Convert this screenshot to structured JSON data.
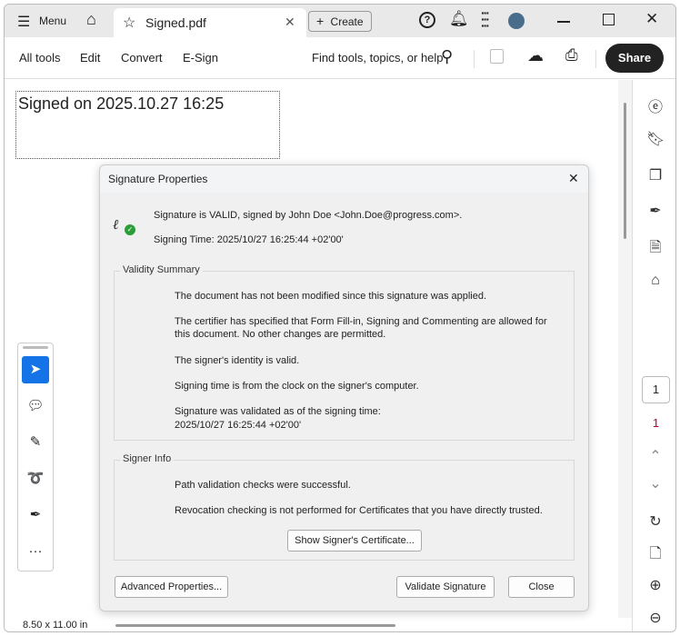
{
  "titlebar": {
    "menu": "Menu",
    "tab_title": "Signed.pdf",
    "create": "Create"
  },
  "toolbar": {
    "all_tools": "All tools",
    "edit": "Edit",
    "convert": "Convert",
    "esign": "E-Sign",
    "search": "Find tools, topics, or help",
    "share": "Share"
  },
  "document": {
    "signature_field": "Signed on 2025.10.27 16:25"
  },
  "dialog": {
    "title": "Signature Properties",
    "status": "Signature is VALID, signed by John Doe <John.Doe@progress.com>.",
    "signing_time": "Signing Time:  2025/10/27 16:25:44 +02'00'",
    "validity": {
      "legend": "Validity Summary",
      "lines": [
        "The document has not been modified since this signature was applied.",
        "The certifier has specified that Form Fill-in, Signing and Commenting are allowed for this document. No other changes are permitted.",
        "The signer's identity is valid.",
        "Signing time is from the clock on the signer's computer.",
        "Signature was validated as of the signing time:",
        "2025/10/27 16:25:44 +02'00'"
      ]
    },
    "signer": {
      "legend": "Signer Info",
      "lines": [
        "Path validation checks were successful.",
        "Revocation checking is not performed for Certificates that you have directly trusted."
      ],
      "show_cert": "Show Signer's Certificate..."
    },
    "advanced": "Advanced Properties...",
    "validate": "Validate Signature",
    "close": "Close"
  },
  "page_nav": {
    "current": "1",
    "total": "1"
  },
  "status": {
    "page_size": "8.50 x 11.00 in"
  },
  "colors": {
    "valid": "#2d9d3a",
    "selected_tool": "#1473e6"
  }
}
